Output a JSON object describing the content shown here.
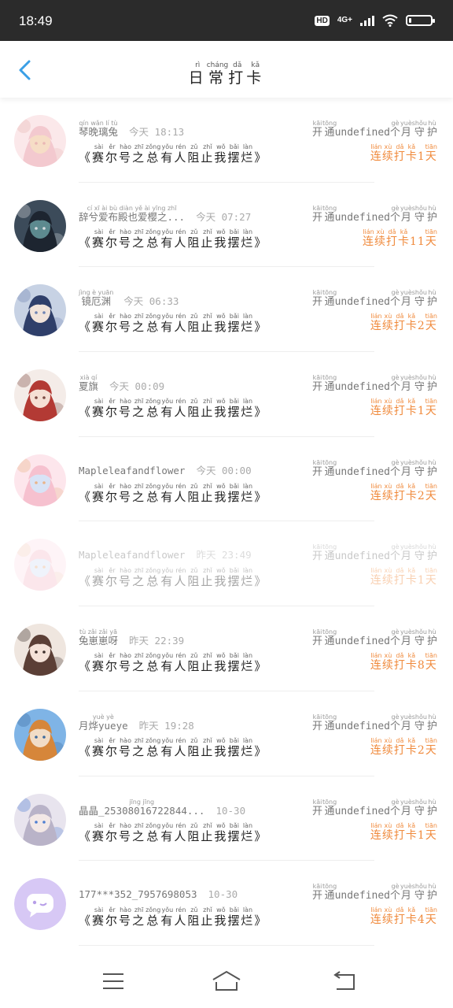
{
  "status": {
    "time": "18:49",
    "hd": "HD",
    "network": "4G+"
  },
  "header": {
    "title": [
      {
        "c": "日",
        "p": "rì"
      },
      {
        "c": "常",
        "p": "cháng"
      },
      {
        "c": "打",
        "p": "dǎ"
      },
      {
        "c": "卡",
        "p": "kǎ"
      }
    ]
  },
  "list": [
    {
      "name": "琴晚璃兔",
      "name_pinyin": "qín wǎn lí tù",
      "time": "今天 18:13",
      "days": "1",
      "faded": false,
      "avatar": "anime-girl-pink"
    },
    {
      "name": "辞兮爱布殿也爱樱之...",
      "name_pinyin": "cí xī ài bù diàn yě ài yīng zhī",
      "time": "今天 07:27",
      "days": "11",
      "faded": false,
      "avatar": "anime-boy-dark"
    },
    {
      "name": "镜厄渊",
      "name_pinyin": "jìng è yuān",
      "time": "今天 06:33",
      "days": "2",
      "faded": false,
      "avatar": "anime-girl-blue"
    },
    {
      "name": "夏旗",
      "name_pinyin": "xià qí",
      "time": "今天 00:09",
      "days": "1",
      "faded": false,
      "avatar": "anime-girl-red-hood"
    },
    {
      "name": "Mapleleafandflower",
      "name_pinyin": "",
      "time": "今天 00:00",
      "days": "2",
      "faded": false,
      "avatar": "anime-girl-flowers"
    },
    {
      "name": "Mapleleafandflower",
      "name_pinyin": "",
      "time": "昨天 23:49",
      "days": "1",
      "faded": true,
      "avatar": "anime-girl-flowers"
    },
    {
      "name": "兔崽崽呀",
      "name_pinyin": "tù zǎi zǎi yā",
      "time": "昨天 22:39",
      "days": "8",
      "faded": false,
      "avatar": "anime-girl-brown"
    },
    {
      "name": "月烨yueye",
      "name_pinyin": "yuè yè",
      "time": "昨天 19:28",
      "days": "2",
      "faded": false,
      "avatar": "anime-boy-goggles"
    },
    {
      "name": "晶晶_25308016722844...",
      "name_pinyin": "jīng jīng",
      "time": "10-30",
      "days": "1",
      "faded": false,
      "avatar": "anime-girl-silver"
    },
    {
      "name": "177***352_7957698053",
      "name_pinyin": "",
      "time": "10-30",
      "days": "4",
      "faded": false,
      "avatar": "default-chat-avatar"
    }
  ],
  "row_texts": {
    "message": [
      {
        "c": "《",
        "p": ""
      },
      {
        "c": "赛",
        "p": "sài"
      },
      {
        "c": "尔",
        "p": "ěr"
      },
      {
        "c": "号",
        "p": "hào"
      },
      {
        "c": "之",
        "p": "zhī"
      },
      {
        "c": "总",
        "p": "zǒng"
      },
      {
        "c": "有",
        "p": "yǒu"
      },
      {
        "c": "人",
        "p": "rén"
      },
      {
        "c": "阻",
        "p": "zǔ"
      },
      {
        "c": "止",
        "p": "zhǐ"
      },
      {
        "c": "我",
        "p": "wǒ"
      },
      {
        "c": "摆",
        "p": "bǎi"
      },
      {
        "c": "烂",
        "p": "làn"
      },
      {
        "c": "》",
        "p": ""
      }
    ],
    "guard_prefix": [
      {
        "c": "开",
        "p": "kāi"
      },
      {
        "c": "通",
        "p": "tōng"
      }
    ],
    "guard_mid": "undefined",
    "guard_suffix": [
      {
        "c": "个",
        "p": "gè"
      },
      {
        "c": "月",
        "p": "yuè"
      },
      {
        "c": "守",
        "p": "shǒu"
      },
      {
        "c": "护",
        "p": "hù"
      }
    ],
    "streak_prefix": [
      {
        "c": "连",
        "p": "lián"
      },
      {
        "c": "续",
        "p": "xù"
      },
      {
        "c": "打",
        "p": "dǎ"
      },
      {
        "c": "卡",
        "p": "kǎ"
      }
    ],
    "streak_suffix": [
      {
        "c": "天",
        "p": "tiān"
      }
    ]
  },
  "colors": {
    "accent": "#f08a3c",
    "back_arrow": "#3a9fe6",
    "status_bar": "#2b2b2b"
  },
  "icons": {
    "back": "chevron-left-icon",
    "nav_menu": "menu-icon",
    "nav_home": "home-icon",
    "nav_back": "return-icon"
  }
}
